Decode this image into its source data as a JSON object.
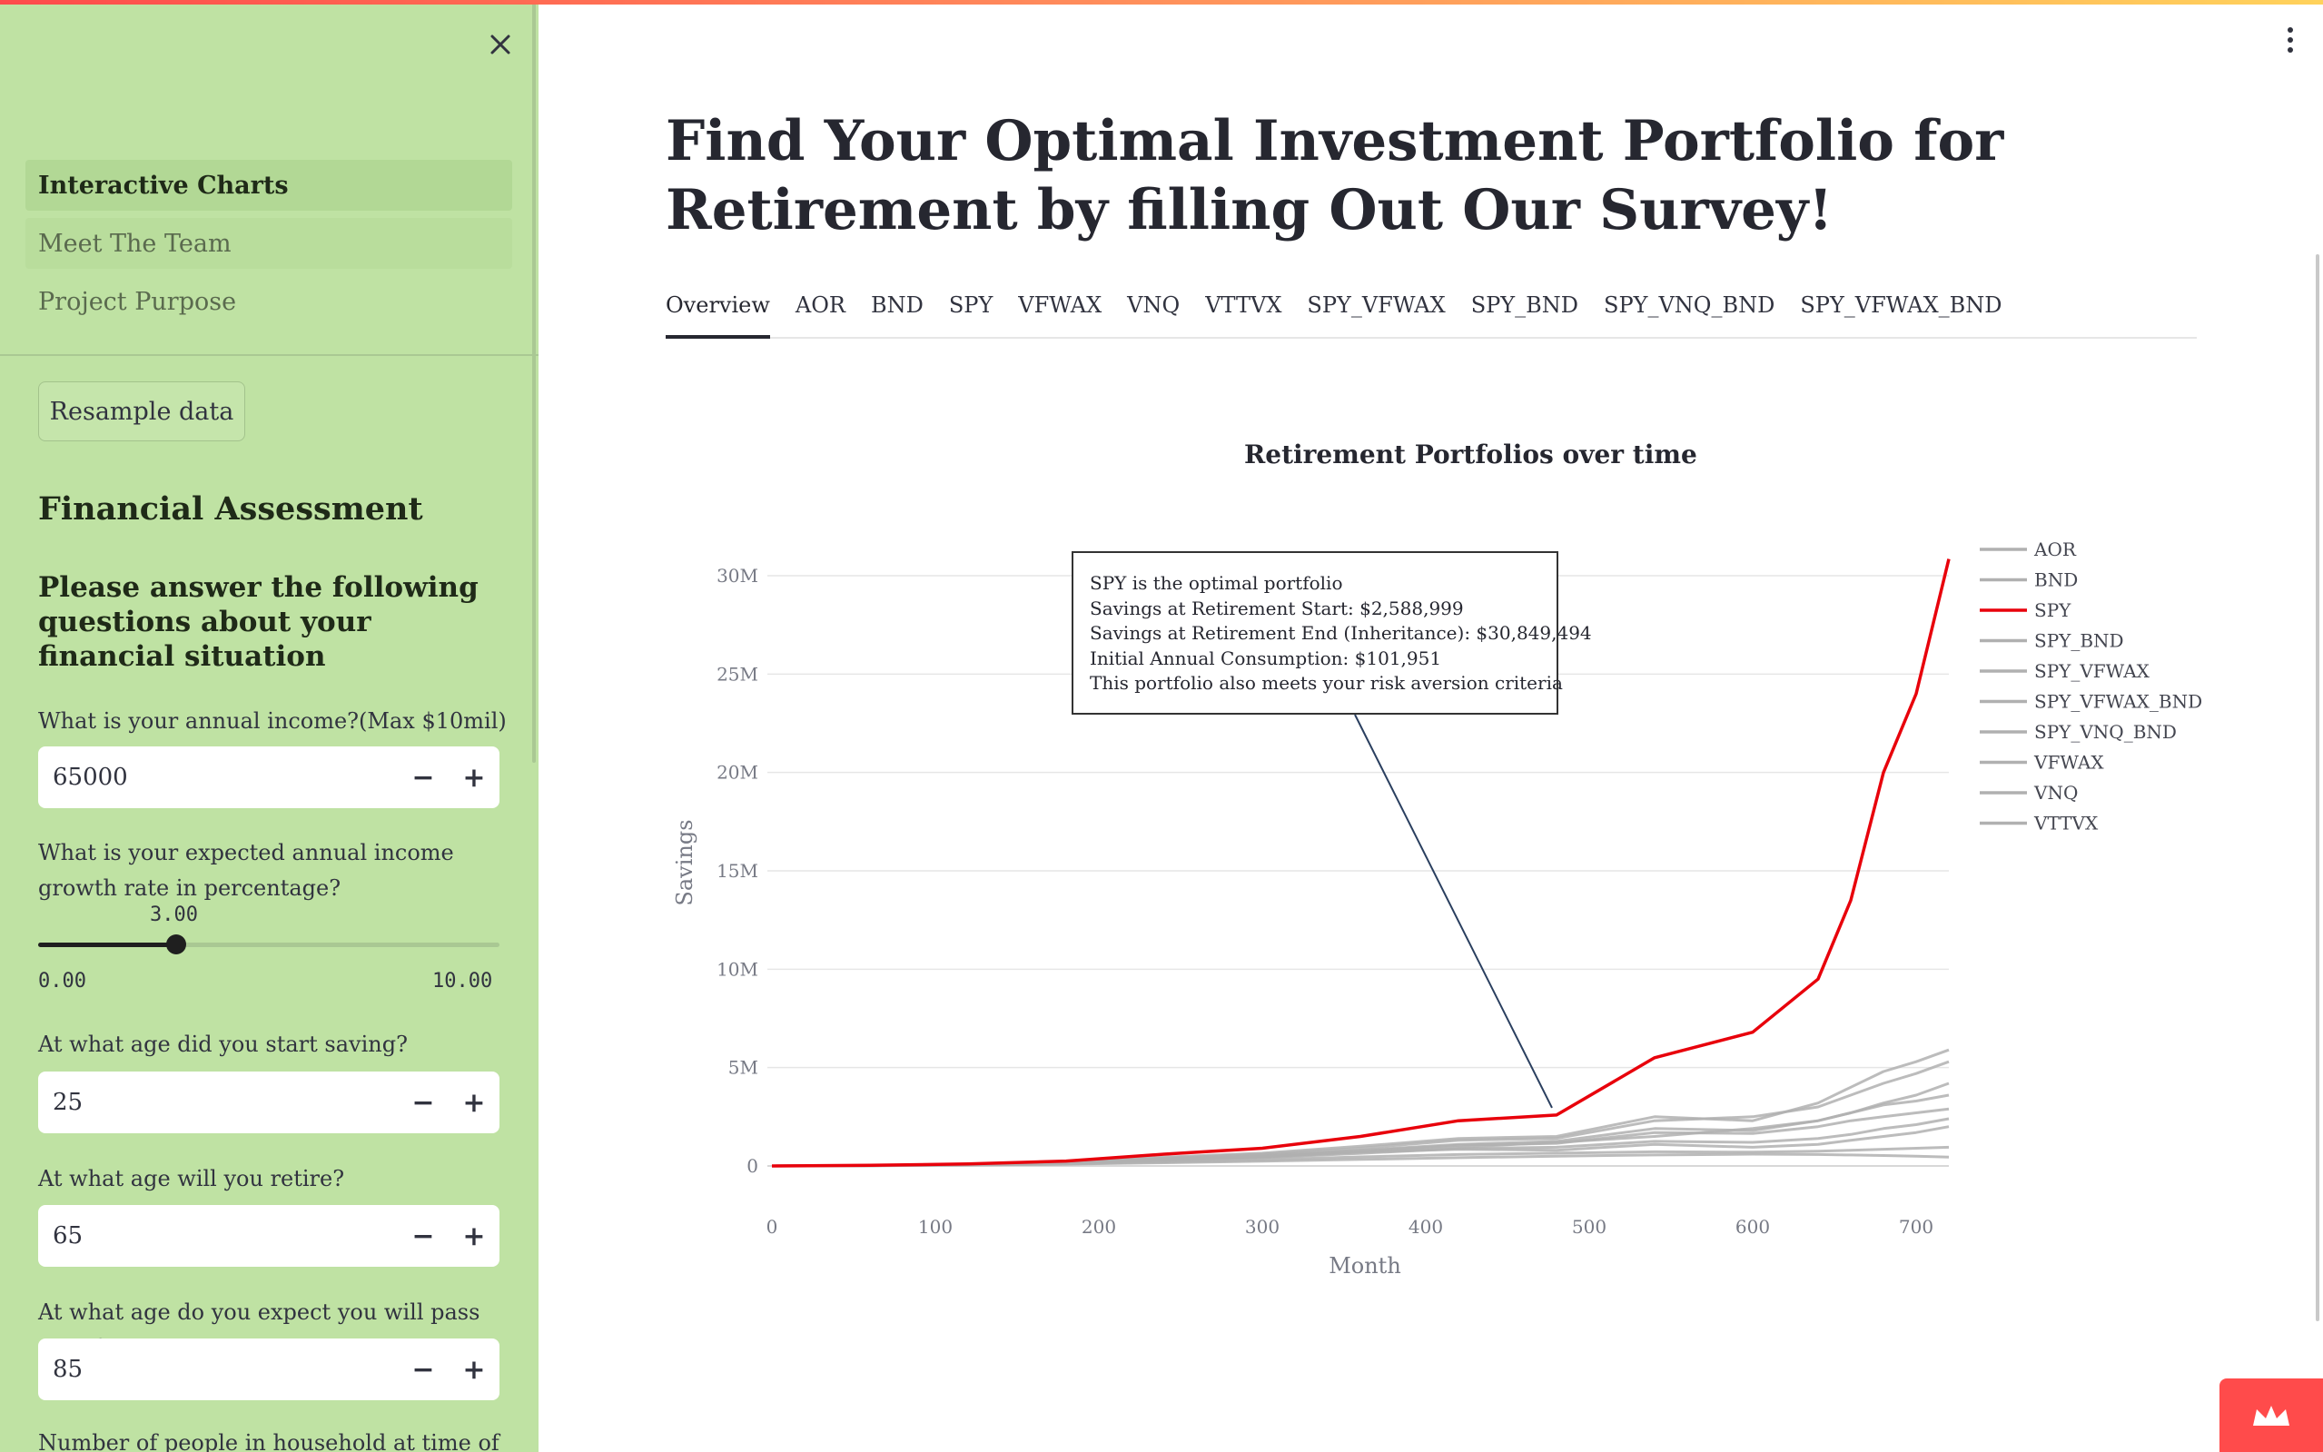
{
  "sidebar": {
    "nav": [
      {
        "label": "Interactive Charts"
      },
      {
        "label": "Meet The Team"
      },
      {
        "label": "Project Purpose"
      }
    ],
    "resample_label": "Resample data",
    "section_title": "Financial Assessment",
    "section_subtitle": "Please answer the following questions about your financial situation",
    "questions": {
      "income": {
        "label": "What is your annual income?(Max $10mil)",
        "value": "65000"
      },
      "growth": {
        "label": "What is your expected annual income growth rate in percentage?",
        "value": "3.00",
        "min": "0.00",
        "max": "10.00",
        "fraction": 0.3
      },
      "start_age": {
        "label": "At what age did you start saving?",
        "value": "25"
      },
      "retire_age": {
        "label": "At what age will you retire?",
        "value": "65"
      },
      "death_age": {
        "label": "At what age do you expect you will pass away?",
        "value": "85"
      },
      "household": {
        "label": "Number of people in household at time of"
      }
    },
    "minus": "−",
    "plus": "+"
  },
  "main": {
    "title": "Find Your Optimal Investment Portfolio for Retirement by filling Out Our Survey!",
    "tabs": [
      "Overview",
      "AOR",
      "BND",
      "SPY",
      "VFWAX",
      "VNQ",
      "VTTVX",
      "SPY_VFWAX",
      "SPY_BND",
      "SPY_VNQ_BND",
      "SPY_VFWAX_BND"
    ],
    "active_tab": "Overview"
  },
  "callout": {
    "lines": [
      "SPY is the optimal portfolio",
      "Savings at Retirement Start: $2,588,999",
      "Savings at Retirement End (Inheritance): $30,849,494",
      "Initial Annual Consumption: $101,951",
      "This portfolio also meets your risk aversion criteria"
    ]
  },
  "colors": {
    "highlight": "#e8000b",
    "others": "#b0b0b0",
    "sidebar_bg": "#bfe2a3",
    "accent": "#ff4b4b"
  },
  "chart_data": {
    "type": "line",
    "title": "Retirement Portfolios over time",
    "xlabel": "Month",
    "ylabel": "Savings",
    "xlim": [
      0,
      720
    ],
    "ylim": [
      0,
      30000000
    ],
    "x_ticks": [
      0,
      100,
      200,
      300,
      400,
      500,
      600,
      700
    ],
    "y_ticks": [
      0,
      5000000,
      10000000,
      15000000,
      20000000,
      25000000,
      30000000
    ],
    "y_tick_labels": [
      "0",
      "5M",
      "10M",
      "15M",
      "20M",
      "25M",
      "30M"
    ],
    "legend_position": "right",
    "highlight_series": "SPY",
    "x": [
      0,
      60,
      120,
      180,
      240,
      300,
      360,
      420,
      480,
      540,
      600,
      640,
      660,
      680,
      700,
      720
    ],
    "series": [
      {
        "name": "AOR",
        "values": [
          0,
          20000,
          60000,
          150000,
          300000,
          450000,
          700000,
          950000,
          1200000,
          1500000,
          1900000,
          2300000,
          2700000,
          3200000,
          3600000,
          4200000
        ]
      },
      {
        "name": "BND",
        "values": [
          0,
          15000,
          40000,
          90000,
          160000,
          240000,
          330000,
          420000,
          500000,
          560000,
          600000,
          580000,
          560000,
          530000,
          500000,
          450000
        ]
      },
      {
        "name": "SPY",
        "values": [
          0,
          30000,
          100000,
          250000,
          600000,
          900000,
          1500000,
          2300000,
          2588999,
          5500000,
          6800000,
          9500000,
          13500000,
          20000000,
          24000000,
          30849494
        ]
      },
      {
        "name": "SPY_BND",
        "values": [
          0,
          25000,
          80000,
          200000,
          400000,
          600000,
          900000,
          1300000,
          1400000,
          2300000,
          2500000,
          3000000,
          3600000,
          4200000,
          4700000,
          5300000
        ]
      },
      {
        "name": "SPY_VFWAX",
        "values": [
          0,
          28000,
          90000,
          220000,
          450000,
          650000,
          1000000,
          1400000,
          1500000,
          2500000,
          2300000,
          3200000,
          4000000,
          4800000,
          5300000,
          5900000
        ]
      },
      {
        "name": "SPY_VFWAX_BND",
        "values": [
          0,
          22000,
          70000,
          180000,
          360000,
          540000,
          800000,
          1100000,
          1250000,
          1900000,
          1800000,
          2300000,
          2700000,
          3100000,
          3300000,
          3600000
        ]
      },
      {
        "name": "SPY_VNQ_BND",
        "values": [
          0,
          20000,
          65000,
          170000,
          340000,
          500000,
          760000,
          1050000,
          1150000,
          1700000,
          1650000,
          2000000,
          2300000,
          2500000,
          2700000,
          2900000
        ]
      },
      {
        "name": "VFWAX",
        "values": [
          0,
          18000,
          55000,
          140000,
          280000,
          420000,
          640000,
          880000,
          950000,
          1250000,
          1200000,
          1400000,
          1600000,
          1900000,
          2100000,
          2400000
        ]
      },
      {
        "name": "VNQ",
        "values": [
          0,
          20000,
          60000,
          160000,
          330000,
          480000,
          700000,
          850000,
          800000,
          1100000,
          950000,
          1100000,
          1300000,
          1500000,
          1700000,
          2000000
        ]
      },
      {
        "name": "VTTVX",
        "values": [
          0,
          15000,
          45000,
          110000,
          210000,
          320000,
          460000,
          580000,
          650000,
          720000,
          700000,
          750000,
          800000,
          850000,
          900000,
          950000
        ]
      }
    ]
  }
}
